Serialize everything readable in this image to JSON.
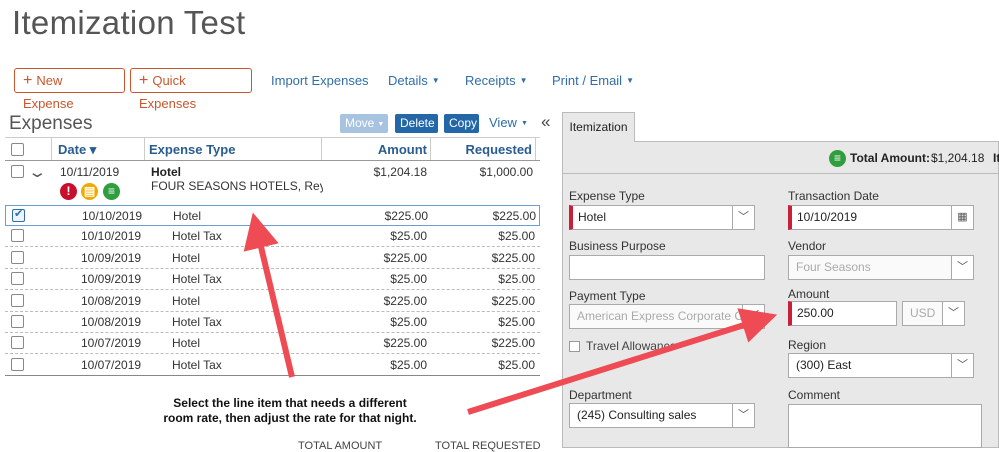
{
  "page": {
    "title": "Itemization Test"
  },
  "toolbar": {
    "new_expense": "New Expense",
    "quick_expenses": "Quick Expenses",
    "import_expenses": "Import Expenses",
    "details": "Details",
    "receipts": "Receipts",
    "print_email": "Print / Email"
  },
  "expenses": {
    "title": "Expenses",
    "move": "Move",
    "delete": "Delete",
    "copy": "Copy",
    "view": "View",
    "collapse_glyph": "«",
    "columns": {
      "date": "Date ▾",
      "type": "Expense Type",
      "amount": "Amount",
      "requested": "Requested"
    },
    "parent": {
      "date": "10/11/2019",
      "type": "Hotel",
      "vendor": "FOUR SEASONS HOTELS, Rey",
      "amount": "$1,204.18",
      "requested": "$1,000.00"
    },
    "rows": [
      {
        "date": "10/10/2019",
        "type": "Hotel",
        "amount": "$225.00",
        "requested": "$225.00"
      },
      {
        "date": "10/10/2019",
        "type": "Hotel Tax",
        "amount": "$25.00",
        "requested": "$25.00"
      },
      {
        "date": "10/09/2019",
        "type": "Hotel",
        "amount": "$225.00",
        "requested": "$225.00"
      },
      {
        "date": "10/09/2019",
        "type": "Hotel Tax",
        "amount": "$25.00",
        "requested": "$25.00"
      },
      {
        "date": "10/08/2019",
        "type": "Hotel",
        "amount": "$225.00",
        "requested": "$225.00"
      },
      {
        "date": "10/08/2019",
        "type": "Hotel Tax",
        "amount": "$25.00",
        "requested": "$25.00"
      },
      {
        "date": "10/07/2019",
        "type": "Hotel",
        "amount": "$225.00",
        "requested": "$225.00"
      },
      {
        "date": "10/07/2019",
        "type": "Hotel Tax",
        "amount": "$25.00",
        "requested": "$25.00"
      }
    ],
    "totals": {
      "amount": "TOTAL AMOUNT",
      "requested": "TOTAL REQUESTED"
    }
  },
  "annotation": {
    "line1": "Select the line item that needs a different",
    "line2": "room rate, then adjust the rate for that night."
  },
  "itemization": {
    "tab": "Itemization",
    "total_label": "Total Amount:",
    "total_value": "$1,204.18",
    "total_cut": "It",
    "expense_type": {
      "label": "Expense Type",
      "value": "Hotel"
    },
    "transaction_date": {
      "label": "Transaction Date",
      "value": "10/10/2019"
    },
    "business_purpose": {
      "label": "Business Purpose",
      "value": ""
    },
    "vendor": {
      "label": "Vendor",
      "value": "Four Seasons"
    },
    "payment_type": {
      "label": "Payment Type",
      "value": "American Express Corporate Ca"
    },
    "amount": {
      "label": "Amount",
      "value": "250.00",
      "currency": "USD"
    },
    "travel_allowance": "Travel Allowance",
    "region": {
      "label": "Region",
      "value": "(300) East"
    },
    "department": {
      "label": "Department",
      "value": "(245) Consulting sales"
    },
    "comment": {
      "label": "Comment",
      "value": ""
    }
  },
  "colors": {
    "accent": "#c8562e",
    "link": "#2f6ea8",
    "required": "#c8203a",
    "arrow": "#ee4b55"
  }
}
